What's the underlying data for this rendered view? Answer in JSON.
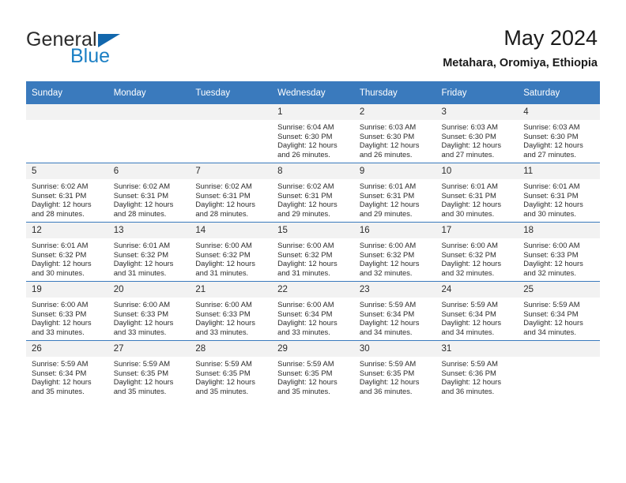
{
  "logo": {
    "word_one": "General",
    "word_two": "Blue",
    "triangle_color": "#1267ad",
    "blue_color": "#1b7fc4"
  },
  "header": {
    "title": "May 2024",
    "subtitle": "Metahara, Oromiya, Ethiopia"
  },
  "theme": {
    "header_bar": "#3a7abd",
    "day_band": "#f2f2f2",
    "text": "#2b2b2b"
  },
  "weekdays": [
    "Sunday",
    "Monday",
    "Tuesday",
    "Wednesday",
    "Thursday",
    "Friday",
    "Saturday"
  ],
  "labels": {
    "sunrise": "Sunrise:",
    "sunset": "Sunset:",
    "daylight": "Daylight:"
  },
  "weeks": [
    [
      {
        "day": "",
        "empty": true
      },
      {
        "day": "",
        "empty": true
      },
      {
        "day": "",
        "empty": true
      },
      {
        "day": "1",
        "sunrise": "Sunrise: 6:04 AM",
        "sunset": "Sunset: 6:30 PM",
        "daylight_1": "Daylight: 12 hours",
        "daylight_2": "and 26 minutes."
      },
      {
        "day": "2",
        "sunrise": "Sunrise: 6:03 AM",
        "sunset": "Sunset: 6:30 PM",
        "daylight_1": "Daylight: 12 hours",
        "daylight_2": "and 26 minutes."
      },
      {
        "day": "3",
        "sunrise": "Sunrise: 6:03 AM",
        "sunset": "Sunset: 6:30 PM",
        "daylight_1": "Daylight: 12 hours",
        "daylight_2": "and 27 minutes."
      },
      {
        "day": "4",
        "sunrise": "Sunrise: 6:03 AM",
        "sunset": "Sunset: 6:30 PM",
        "daylight_1": "Daylight: 12 hours",
        "daylight_2": "and 27 minutes."
      }
    ],
    [
      {
        "day": "5",
        "sunrise": "Sunrise: 6:02 AM",
        "sunset": "Sunset: 6:31 PM",
        "daylight_1": "Daylight: 12 hours",
        "daylight_2": "and 28 minutes."
      },
      {
        "day": "6",
        "sunrise": "Sunrise: 6:02 AM",
        "sunset": "Sunset: 6:31 PM",
        "daylight_1": "Daylight: 12 hours",
        "daylight_2": "and 28 minutes."
      },
      {
        "day": "7",
        "sunrise": "Sunrise: 6:02 AM",
        "sunset": "Sunset: 6:31 PM",
        "daylight_1": "Daylight: 12 hours",
        "daylight_2": "and 28 minutes."
      },
      {
        "day": "8",
        "sunrise": "Sunrise: 6:02 AM",
        "sunset": "Sunset: 6:31 PM",
        "daylight_1": "Daylight: 12 hours",
        "daylight_2": "and 29 minutes."
      },
      {
        "day": "9",
        "sunrise": "Sunrise: 6:01 AM",
        "sunset": "Sunset: 6:31 PM",
        "daylight_1": "Daylight: 12 hours",
        "daylight_2": "and 29 minutes."
      },
      {
        "day": "10",
        "sunrise": "Sunrise: 6:01 AM",
        "sunset": "Sunset: 6:31 PM",
        "daylight_1": "Daylight: 12 hours",
        "daylight_2": "and 30 minutes."
      },
      {
        "day": "11",
        "sunrise": "Sunrise: 6:01 AM",
        "sunset": "Sunset: 6:31 PM",
        "daylight_1": "Daylight: 12 hours",
        "daylight_2": "and 30 minutes."
      }
    ],
    [
      {
        "day": "12",
        "sunrise": "Sunrise: 6:01 AM",
        "sunset": "Sunset: 6:32 PM",
        "daylight_1": "Daylight: 12 hours",
        "daylight_2": "and 30 minutes."
      },
      {
        "day": "13",
        "sunrise": "Sunrise: 6:01 AM",
        "sunset": "Sunset: 6:32 PM",
        "daylight_1": "Daylight: 12 hours",
        "daylight_2": "and 31 minutes."
      },
      {
        "day": "14",
        "sunrise": "Sunrise: 6:00 AM",
        "sunset": "Sunset: 6:32 PM",
        "daylight_1": "Daylight: 12 hours",
        "daylight_2": "and 31 minutes."
      },
      {
        "day": "15",
        "sunrise": "Sunrise: 6:00 AM",
        "sunset": "Sunset: 6:32 PM",
        "daylight_1": "Daylight: 12 hours",
        "daylight_2": "and 31 minutes."
      },
      {
        "day": "16",
        "sunrise": "Sunrise: 6:00 AM",
        "sunset": "Sunset: 6:32 PM",
        "daylight_1": "Daylight: 12 hours",
        "daylight_2": "and 32 minutes."
      },
      {
        "day": "17",
        "sunrise": "Sunrise: 6:00 AM",
        "sunset": "Sunset: 6:32 PM",
        "daylight_1": "Daylight: 12 hours",
        "daylight_2": "and 32 minutes."
      },
      {
        "day": "18",
        "sunrise": "Sunrise: 6:00 AM",
        "sunset": "Sunset: 6:33 PM",
        "daylight_1": "Daylight: 12 hours",
        "daylight_2": "and 32 minutes."
      }
    ],
    [
      {
        "day": "19",
        "sunrise": "Sunrise: 6:00 AM",
        "sunset": "Sunset: 6:33 PM",
        "daylight_1": "Daylight: 12 hours",
        "daylight_2": "and 33 minutes."
      },
      {
        "day": "20",
        "sunrise": "Sunrise: 6:00 AM",
        "sunset": "Sunset: 6:33 PM",
        "daylight_1": "Daylight: 12 hours",
        "daylight_2": "and 33 minutes."
      },
      {
        "day": "21",
        "sunrise": "Sunrise: 6:00 AM",
        "sunset": "Sunset: 6:33 PM",
        "daylight_1": "Daylight: 12 hours",
        "daylight_2": "and 33 minutes."
      },
      {
        "day": "22",
        "sunrise": "Sunrise: 6:00 AM",
        "sunset": "Sunset: 6:34 PM",
        "daylight_1": "Daylight: 12 hours",
        "daylight_2": "and 33 minutes."
      },
      {
        "day": "23",
        "sunrise": "Sunrise: 5:59 AM",
        "sunset": "Sunset: 6:34 PM",
        "daylight_1": "Daylight: 12 hours",
        "daylight_2": "and 34 minutes."
      },
      {
        "day": "24",
        "sunrise": "Sunrise: 5:59 AM",
        "sunset": "Sunset: 6:34 PM",
        "daylight_1": "Daylight: 12 hours",
        "daylight_2": "and 34 minutes."
      },
      {
        "day": "25",
        "sunrise": "Sunrise: 5:59 AM",
        "sunset": "Sunset: 6:34 PM",
        "daylight_1": "Daylight: 12 hours",
        "daylight_2": "and 34 minutes."
      }
    ],
    [
      {
        "day": "26",
        "sunrise": "Sunrise: 5:59 AM",
        "sunset": "Sunset: 6:34 PM",
        "daylight_1": "Daylight: 12 hours",
        "daylight_2": "and 35 minutes."
      },
      {
        "day": "27",
        "sunrise": "Sunrise: 5:59 AM",
        "sunset": "Sunset: 6:35 PM",
        "daylight_1": "Daylight: 12 hours",
        "daylight_2": "and 35 minutes."
      },
      {
        "day": "28",
        "sunrise": "Sunrise: 5:59 AM",
        "sunset": "Sunset: 6:35 PM",
        "daylight_1": "Daylight: 12 hours",
        "daylight_2": "and 35 minutes."
      },
      {
        "day": "29",
        "sunrise": "Sunrise: 5:59 AM",
        "sunset": "Sunset: 6:35 PM",
        "daylight_1": "Daylight: 12 hours",
        "daylight_2": "and 35 minutes."
      },
      {
        "day": "30",
        "sunrise": "Sunrise: 5:59 AM",
        "sunset": "Sunset: 6:35 PM",
        "daylight_1": "Daylight: 12 hours",
        "daylight_2": "and 36 minutes."
      },
      {
        "day": "31",
        "sunrise": "Sunrise: 5:59 AM",
        "sunset": "Sunset: 6:36 PM",
        "daylight_1": "Daylight: 12 hours",
        "daylight_2": "and 36 minutes."
      },
      {
        "day": "",
        "empty": true
      }
    ]
  ]
}
